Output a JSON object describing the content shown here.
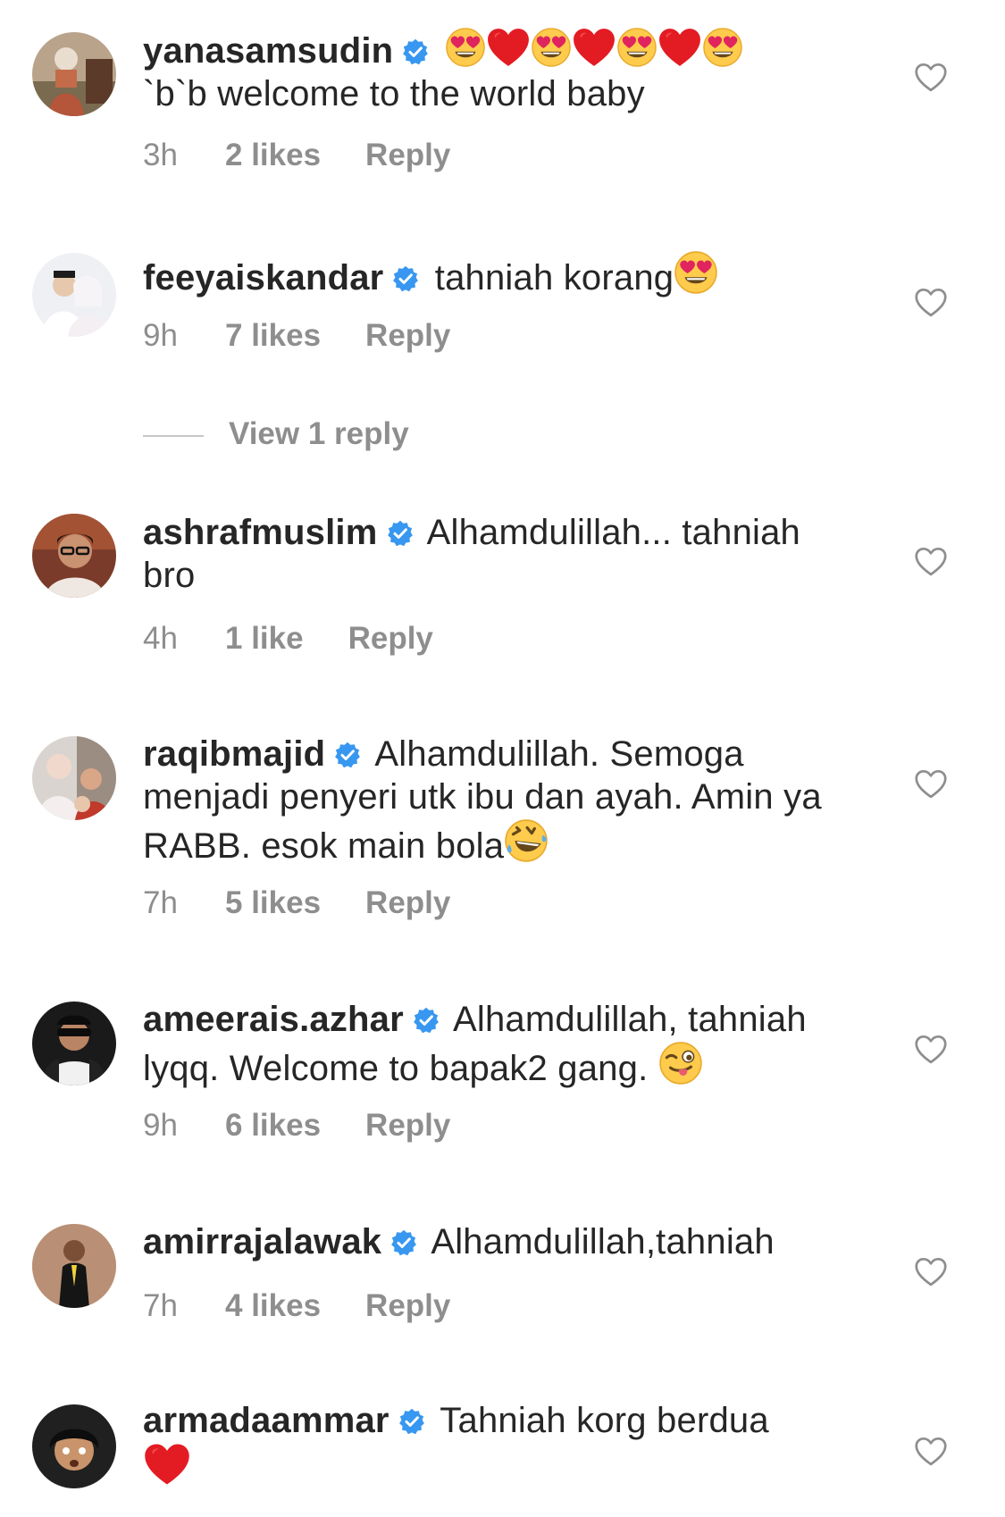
{
  "comments": [
    {
      "username": "yanasamsudin",
      "text": "`b`b welcome to the world baby",
      "time": "3h",
      "likes": "2 likes",
      "reply": "Reply"
    },
    {
      "username": "feeyaiskandar",
      "text": "tahniah korang",
      "time": "9h",
      "likes": "7 likes",
      "reply": "Reply",
      "view_replies": "View 1 reply"
    },
    {
      "username": "ashrafmuslim",
      "text": "Alhamdulillah... tahniah bro",
      "time": "4h",
      "likes": "1 like",
      "reply": "Reply"
    },
    {
      "username": "raqibmajid",
      "text": "Alhamdulillah. Semoga menjadi penyeri utk ibu dan ayah. Amin ya RABB. esok main bola",
      "time": "7h",
      "likes": "5 likes",
      "reply": "Reply"
    },
    {
      "username": "ameerais.azhar",
      "text": "Alhamdulillah, tahniah lyqq. Welcome to bapak2 gang.",
      "time": "9h",
      "likes": "6 likes",
      "reply": "Reply"
    },
    {
      "username": "amirrajalawak",
      "text": "Alhamdulillah,tahniah",
      "time": "7h",
      "likes": "4 likes",
      "reply": "Reply"
    },
    {
      "username": "armadaammar",
      "text": "Tahniah korg berdua",
      "time": "",
      "likes": "",
      "reply": ""
    }
  ],
  "icons": {
    "verified": "verified-badge-icon",
    "like": "heart-outline-icon",
    "emoji_heart_eyes": "heart-eyes-emoji",
    "emoji_red_heart": "red-heart-emoji",
    "emoji_rofl": "rolling-laughing-emoji",
    "emoji_wink_tongue": "winking-tongue-emoji"
  },
  "colors": {
    "verified": "#3897f0",
    "text": "#262626",
    "secondary": "#8e8e8e",
    "heart_outline": "#8e8e8e"
  }
}
